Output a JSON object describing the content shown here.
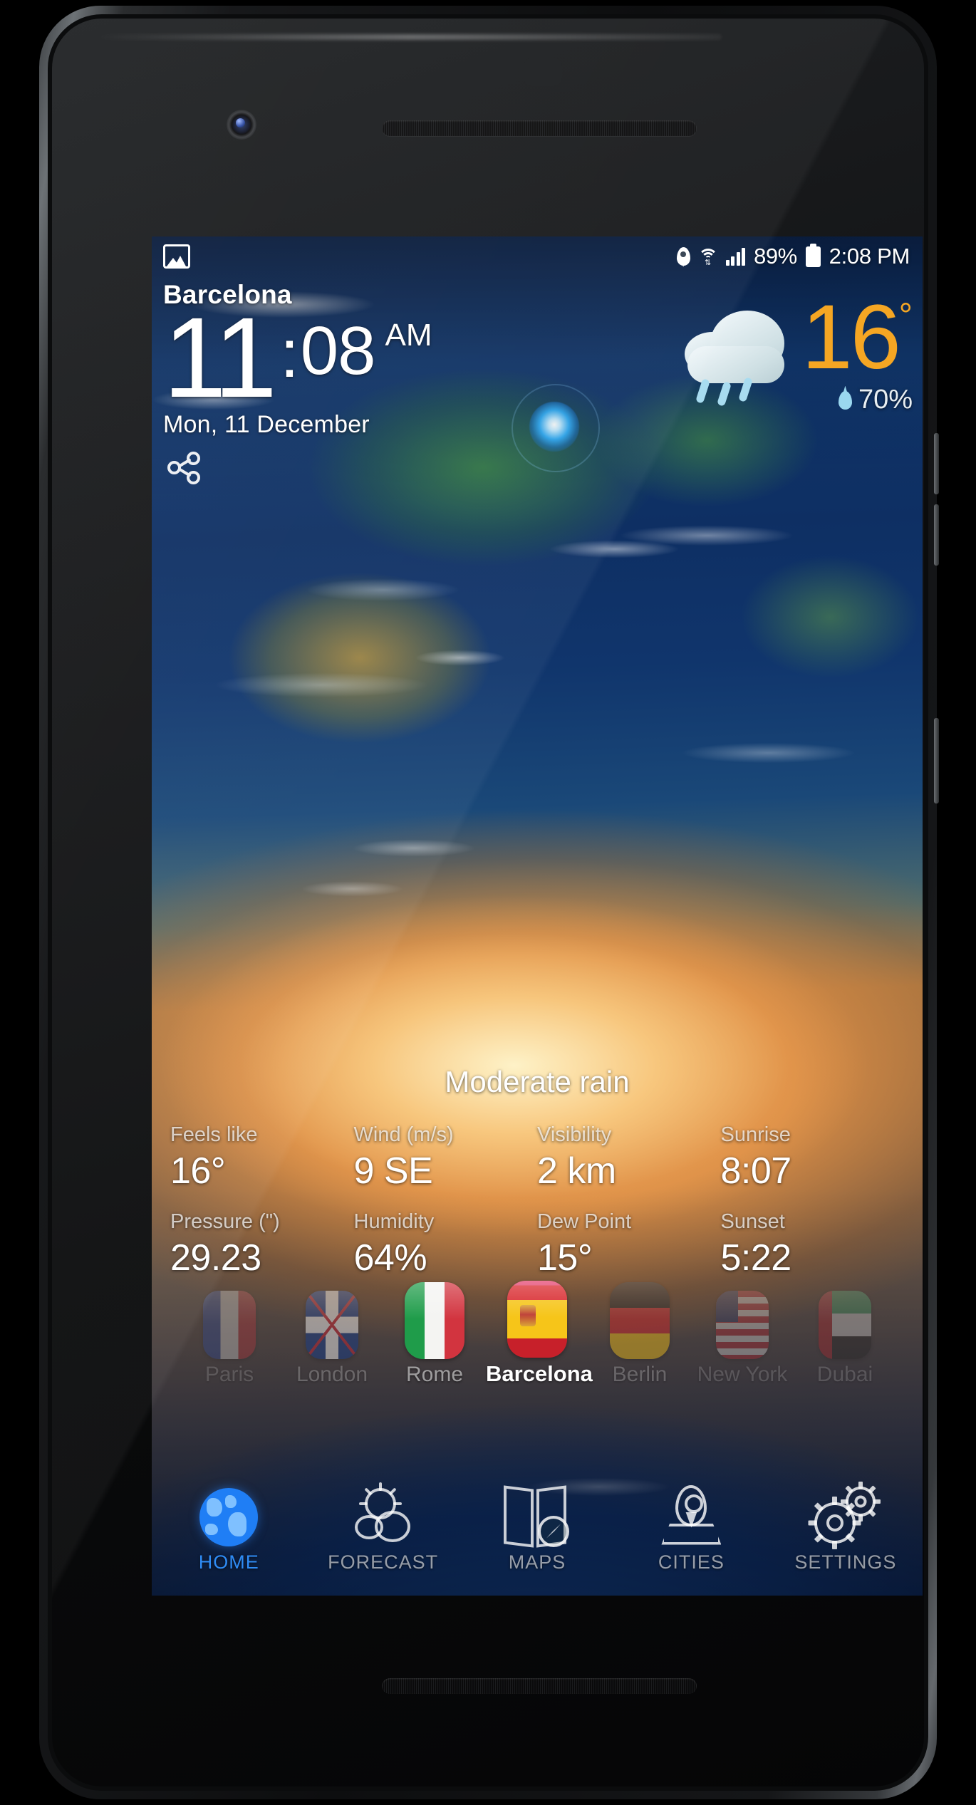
{
  "device": {
    "kind": "android-smartphone"
  },
  "status_bar": {
    "gallery_icon": "image-icon",
    "location_icon": "location-pin-icon",
    "wifi_icon": "wifi-icon",
    "signal_icon": "cell-signal-icon",
    "battery_percent": "89%",
    "battery_icon": "battery-full-icon",
    "time": "2:08 PM"
  },
  "header": {
    "city": "Barcelona",
    "clock_hours": "11",
    "clock_colon": ":",
    "clock_minutes": "08",
    "clock_ampm": "AM",
    "date": "Mon, 11 December",
    "share_icon": "share-icon"
  },
  "current": {
    "condition_icon": "rain-cloud-icon",
    "temperature": "16",
    "degree": "°",
    "precip_icon": "water-drop-icon",
    "precip_probability": "70%",
    "condition_text": "Moderate rain",
    "accent_color": "#f5a623"
  },
  "details": {
    "rows": [
      [
        {
          "label": "Feels like",
          "value": "16°"
        },
        {
          "label": "Wind (m/s)",
          "value": "9 SE"
        },
        {
          "label": "Visibility",
          "value": "2 km"
        },
        {
          "label": "Sunrise",
          "value": "8:07"
        }
      ],
      [
        {
          "label": "Pressure (\")",
          "value": "29.23"
        },
        {
          "label": "Humidity",
          "value": "64%"
        },
        {
          "label": "Dew Point",
          "value": "15°"
        },
        {
          "label": "Sunset",
          "value": "5:22"
        }
      ]
    ]
  },
  "cities": [
    {
      "name": "Paris",
      "flag": "france-flag",
      "selected": false
    },
    {
      "name": "London",
      "flag": "united-kingdom-flag",
      "selected": false
    },
    {
      "name": "Rome",
      "flag": "italy-flag",
      "selected": false
    },
    {
      "name": "Barcelona",
      "flag": "spain-flag",
      "selected": true
    },
    {
      "name": "Berlin",
      "flag": "germany-flag",
      "selected": false
    },
    {
      "name": "New York",
      "flag": "united-states-flag",
      "selected": false
    },
    {
      "name": "Dubai",
      "flag": "uae-flag",
      "selected": false
    }
  ],
  "nav": [
    {
      "label": "HOME",
      "icon": "globe-icon",
      "active": true
    },
    {
      "label": "FORECAST",
      "icon": "sun-cloud-icon",
      "active": false
    },
    {
      "label": "MAPS",
      "icon": "map-icon",
      "active": false
    },
    {
      "label": "CITIES",
      "icon": "location-pin-icon",
      "active": false
    },
    {
      "label": "SETTINGS",
      "icon": "gears-icon",
      "active": false
    }
  ],
  "map": {
    "marker": "current-location-glow-marker",
    "accent_color": "#2ea9f2"
  }
}
